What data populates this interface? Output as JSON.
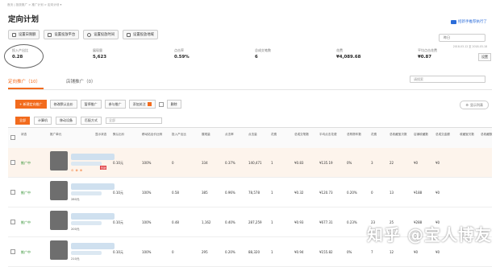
{
  "breadcrumb": "首页 | 投放推广 > 推广计划 > 定向计划 ▾",
  "page_title": "定向计划",
  "help_link": "招新手推荐执行了",
  "buttons": [
    "设置日限额",
    "设置投放平台",
    "设置投放时间",
    "设置投放地域"
  ],
  "date_box": "昨日",
  "date_range": "2018-03-12 至 2018-03-18",
  "metrics": [
    {
      "label": "投入产出比",
      "value": "0.28"
    },
    {
      "label": "展现量",
      "value": "5,623"
    },
    {
      "label": "点击率",
      "value": "0.59%"
    },
    {
      "label": "总成交笔数",
      "value": "6"
    },
    {
      "label": "花费",
      "value": "¥4,089.68"
    },
    {
      "label": "平均点击花费",
      "value": "¥0.87"
    }
  ],
  "settings_label": "设置",
  "tabs": {
    "active": "定向推广（10）",
    "inactive": "店铺推广（0）"
  },
  "search_placeholder": "请搜索",
  "toolbar": {
    "new": "+ 新建定向推广",
    "b2": "修改默认出价",
    "b3": "暂停推广",
    "b4": "参与推广",
    "b5": "添加关注",
    "b6": "删除"
  },
  "toolbar_right": "显示列表",
  "filter": {
    "all": "全部",
    "f2": "计算机",
    "f3": "移动设备",
    "f4": "匹配方式",
    "select": "全部"
  },
  "columns": [
    "状态",
    "推广单元",
    "显示状态",
    "默认出价",
    "移动站出价比例",
    "投入产出比",
    "展现量",
    "点击率",
    "点击量",
    "花费",
    "总成交笔数",
    "平均点击花费",
    "总购物车数",
    "花费",
    "总收藏宝贝数",
    "店铺收藏数",
    "总成交金额",
    "收藏宝贝数",
    "总收藏数"
  ],
  "rows": [
    {
      "status": "推广中",
      "price": "0.10元",
      "bid": "0.10元",
      "ratio": "100%",
      "roi": "0",
      "shows": "334",
      "ctr": "0.37%",
      "clicks": "140,471",
      "a": "1",
      "cost": "¥0.83",
      "cart": "¥135.19",
      "fav": "0%",
      "b": "3",
      "c": "22",
      "d": "¥0",
      "e": "¥0"
    },
    {
      "status": "推广中",
      "price": "280元",
      "bid": "0.10元",
      "ratio": "100%",
      "roi": "0.58",
      "shows": "385",
      "ctr": "0.96%",
      "clicks": "78,578",
      "a": "1",
      "cost": "¥0.32",
      "cart": "¥120.73",
      "fav": "0.20%",
      "b": "0",
      "c": "13",
      "d": "¥188",
      "e": "¥0"
    },
    {
      "status": "推广中",
      "price": "200元",
      "bid": "0.10元",
      "ratio": "100%",
      "roi": "0.48",
      "shows": "1,162",
      "ctr": "0.40%",
      "clicks": "287,259",
      "a": "1",
      "cost": "¥0.93",
      "cart": "¥677.31",
      "fav": "0.23%",
      "b": "23",
      "c": "25",
      "d": "¥288",
      "e": "¥0"
    },
    {
      "status": "推广中",
      "price": "210元",
      "bid": "0.10元",
      "ratio": "100%",
      "roi": "0",
      "shows": "295",
      "ctr": "0.20%",
      "clicks": "88,320",
      "a": "1",
      "cost": "¥0.94",
      "cart": "¥155.82",
      "fav": "0%",
      "b": "7",
      "c": "12",
      "d": "¥0",
      "e": "¥0"
    }
  ],
  "tag_label": "热销",
  "watermark": "知乎 @宝人博友"
}
